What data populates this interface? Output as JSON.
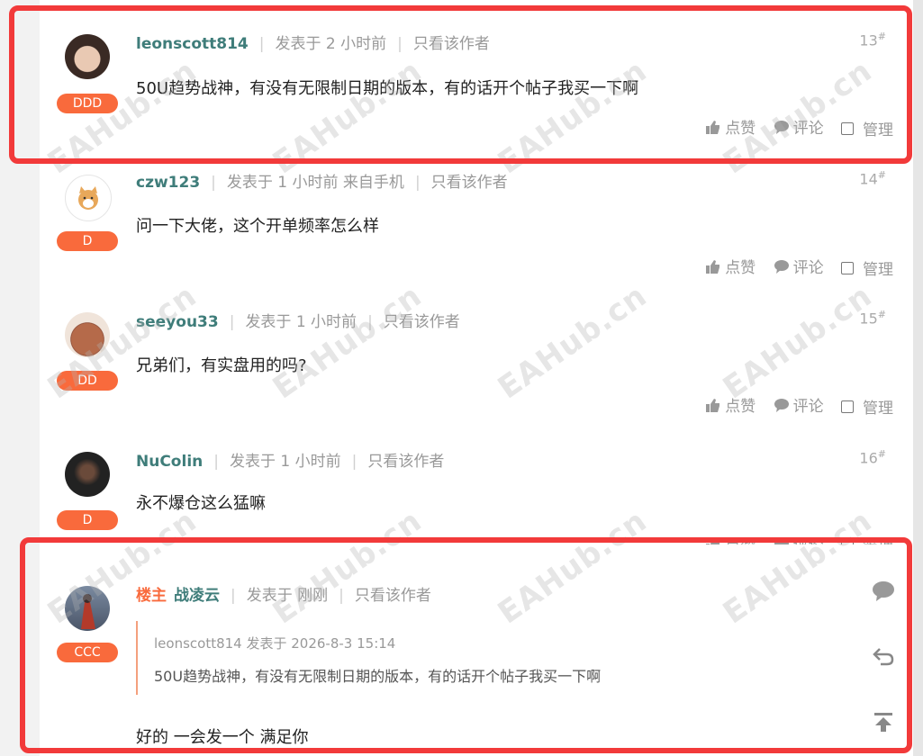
{
  "watermark": "EAHub.cn",
  "accent_color": "#f96a3c",
  "username_color": "#3f7d7a",
  "highlight_color": "#f23a3a",
  "action_labels": {
    "like": "点赞",
    "comment": "评论",
    "manage": "管理"
  },
  "posts": [
    {
      "username": "leonscott814",
      "posted": "发表于 2 小时前",
      "view_author": "只看该作者",
      "floor": "13",
      "badge": "DDD",
      "content": "50U趋势战神，有没有无限制日期的版本，有的话开个帖子我买一下啊"
    },
    {
      "username": "czw123",
      "posted": "发表于 1 小时前 来自手机",
      "view_author": "只看该作者",
      "floor": "14",
      "badge": "D",
      "content": "问一下大佬，这个开单频率怎么样"
    },
    {
      "username": "seeyou33",
      "posted": "发表于 1 小时前",
      "view_author": "只看该作者",
      "floor": "15",
      "badge": "DD",
      "content": "兄弟们，有实盘用的吗?"
    },
    {
      "username": "NuColin",
      "posted": "发表于 1 小时前",
      "view_author": "只看该作者",
      "floor": "16",
      "badge": "D",
      "content": "永不爆仓这么猛嘛"
    }
  ],
  "reply": {
    "owner_tag": "楼主",
    "username": "战凌云",
    "posted": "发表于 刚刚",
    "view_author": "只看该作者",
    "badge": "CCC",
    "quote_meta": "leonscott814 发表于 2026-8-3 15:14",
    "quote_text": "50U趋势战神，有没有无限制日期的版本，有的话开个帖子我买一下啊",
    "content": "好的  一会发一个  满足你"
  }
}
